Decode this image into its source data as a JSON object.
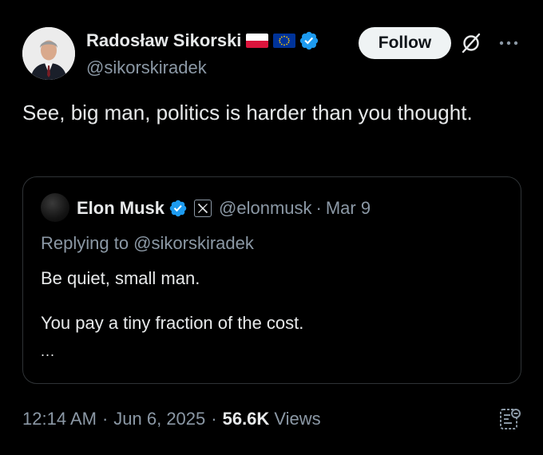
{
  "author": {
    "display_name": "Radosław Sikorski",
    "handle": "@sikorskiradek",
    "flags": [
      "poland-flag-icon",
      "eu-flag-icon"
    ],
    "verified_icon": "verified-badge-icon",
    "verified_color": "#1d9bf0"
  },
  "actions": {
    "follow_label": "Follow",
    "grok_icon": "grok-icon",
    "more_icon": "more-icon"
  },
  "tweet": {
    "text": "See, big man, politics is harder than you thought."
  },
  "quoted": {
    "display_name": "Elon Musk",
    "handle": "@elonmusk",
    "separator": "·",
    "date": "Mar 9",
    "affiliation_icon": "x-logo-icon",
    "replying_to": "Replying to @sikorskiradek",
    "body_line1": "Be quiet, small man.",
    "body_line2": "You pay a tiny fraction of the cost.",
    "ellipsis": "..."
  },
  "meta": {
    "time": "12:14 AM",
    "separator": "·",
    "date": "Jun 6, 2025",
    "views_count": "56.6K",
    "views_label": "Views",
    "stats_icon": "post-engagements-icon"
  },
  "colors": {
    "background": "#000000",
    "text_primary": "#e7e9ea",
    "text_secondary": "#8b98a5",
    "border": "#2f3336",
    "follow_bg": "#eff3f4"
  }
}
